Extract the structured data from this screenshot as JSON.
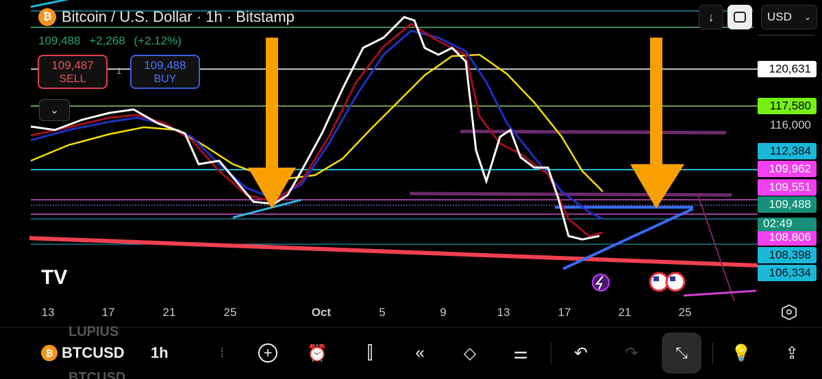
{
  "header": {
    "title": "Bitcoin / U.S. Dollar · 1h · Bitstamp",
    "last": "109,488",
    "change": "+2,268",
    "change_pct": "(+2.12%)"
  },
  "trade": {
    "sell_price": "109,487",
    "sell_label": "SELL",
    "buy_price": "109,488",
    "buy_label": "BUY",
    "quantity": "1"
  },
  "top_right": {
    "currency": "USD"
  },
  "price_axis": [
    {
      "value": "120,631",
      "bg": "#ffffff",
      "fg": "#000000"
    },
    {
      "value": "117,580",
      "bg": "#76f013",
      "fg": "#000000"
    },
    {
      "value": "116,000",
      "bg": "transparent",
      "fg": "#cccccc"
    },
    {
      "value": "112,384",
      "bg": "#1bb8d8",
      "fg": "#0a1a20"
    },
    {
      "value": "109,962",
      "bg": "#f23ff0",
      "fg": "#ffffff"
    },
    {
      "value": "109,551",
      "bg": "#f23ff0",
      "fg": "#ffffff"
    },
    {
      "value": "109,488",
      "bg": "#17907a",
      "fg": "#e8fff8"
    },
    {
      "value": "108,806",
      "bg": "#f23ff0",
      "fg": "#ffffff"
    },
    {
      "value": "108,398",
      "bg": "#1bb8d8",
      "fg": "#0a1a20"
    },
    {
      "value": "106,334",
      "bg": "#1bb8d8",
      "fg": "#0a1a20"
    }
  ],
  "countdown": "02:49",
  "time_axis": [
    "13",
    "17",
    "21",
    "25",
    "Oct",
    "5",
    "9",
    "13",
    "17",
    "21",
    "25"
  ],
  "toolbar": {
    "symbol": "BTCUSD",
    "symbol_prev": "LUPIUS",
    "symbol_next": "BTCUSD",
    "interval": "1h"
  },
  "colors": {
    "up": "#26a17b",
    "sell": "#f0505e",
    "buy": "#4a74ff",
    "arrow": "#f7a000",
    "ma_yellow": "#f5e000"
  }
}
